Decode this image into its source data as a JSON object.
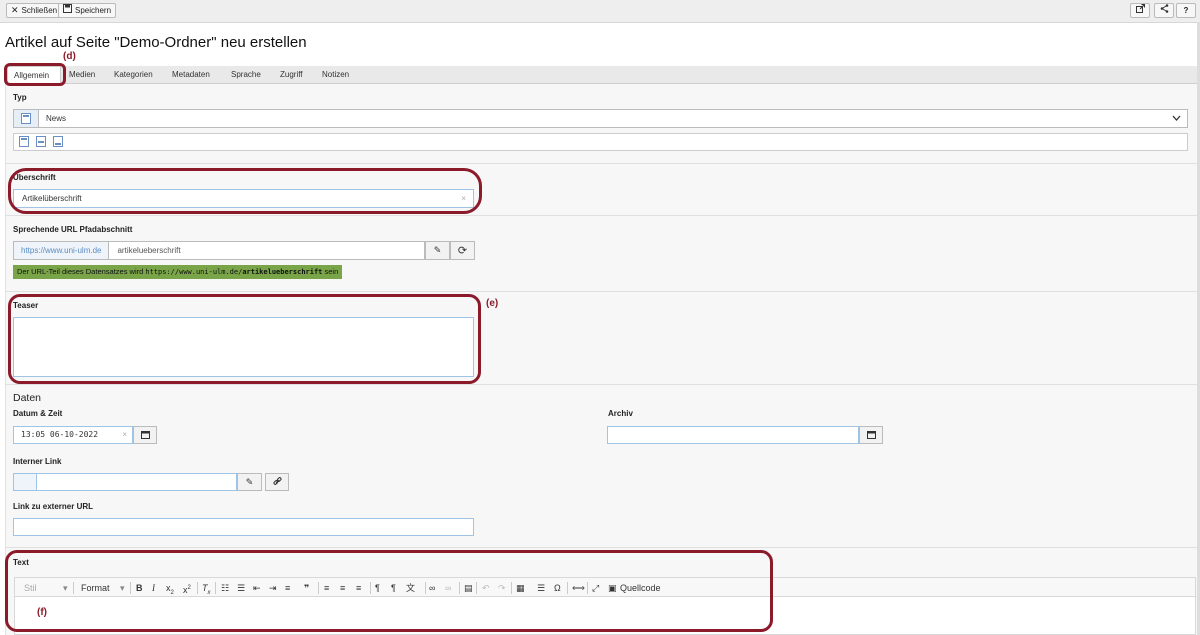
{
  "toolbar": {
    "close_label": "Schließen",
    "save_label": "Speichern",
    "help_label": "?"
  },
  "page": {
    "title": "Artikel auf Seite \"Demo-Ordner\" neu erstellen"
  },
  "tabs": [
    {
      "label": "Allgemein"
    },
    {
      "label": "Medien"
    },
    {
      "label": "Kategorien"
    },
    {
      "label": "Metadaten"
    },
    {
      "label": "Sprache"
    },
    {
      "label": "Zugriff"
    },
    {
      "label": "Notizen"
    }
  ],
  "typ": {
    "label": "Typ",
    "value": "News"
  },
  "headline": {
    "label": "Überschrift",
    "value": "Artikelüberschrift"
  },
  "slug": {
    "label": "Sprechende URL Pfadabschnitt",
    "prefix": "https://www.uni-ulm.de",
    "value": "artikelueberschrift",
    "hint_text": "Der URL-Teil dieses Datensatzes wird",
    "hint_url_base": "https://www.uni-ulm.de/",
    "hint_url_slug": "artikelueberschrift",
    "hint_suffix": "sein",
    "hint_color": "#79a548"
  },
  "teaser": {
    "label": "Teaser",
    "value": ""
  },
  "dates": {
    "section_title": "Daten",
    "datetime_label": "Datum & Zeit",
    "datetime_value": "13:05 06-10-2022",
    "archive_label": "Archiv",
    "archive_value": ""
  },
  "internal_link": {
    "label": "Interner Link",
    "value": ""
  },
  "external_link": {
    "label": "Link zu externer URL",
    "value": ""
  },
  "text": {
    "label": "Text",
    "style_placeholder": "Stil",
    "format_label": "Format",
    "source_label": "Quellcode"
  },
  "annotations": {
    "d": "(d)",
    "e": "(e)",
    "f": "(f)",
    "highlight_color": "#8b1a2a"
  }
}
